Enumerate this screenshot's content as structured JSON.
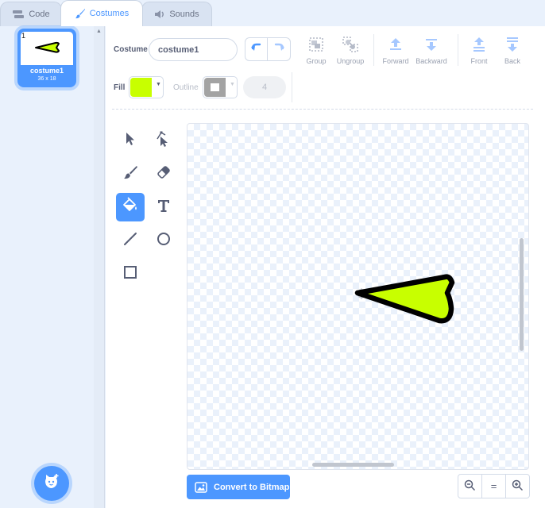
{
  "tabs": [
    {
      "label": "Code",
      "icon": "code-blocks-icon"
    },
    {
      "label": "Costumes",
      "icon": "paintbrush-icon"
    },
    {
      "label": "Sounds",
      "icon": "speaker-icon"
    }
  ],
  "sidebar": {
    "costume": {
      "number": "1",
      "name": "costume1",
      "size": "36 x 18"
    },
    "choose_button_icon": "cat-plus-icon"
  },
  "toolbar": {
    "costume_label": "Costume",
    "costume_name": "costume1",
    "group_label": "Group",
    "ungroup_label": "Ungroup",
    "forward_label": "Forward",
    "backward_label": "Backward",
    "front_label": "Front",
    "back_label": "Back",
    "fill_label": "Fill",
    "fill_color": "#c8ff00",
    "outline_label": "Outline",
    "outline_size": "4"
  },
  "tools": [
    {
      "name": "select",
      "selected": false
    },
    {
      "name": "reshape",
      "selected": false
    },
    {
      "name": "brush",
      "selected": false
    },
    {
      "name": "eraser",
      "selected": false
    },
    {
      "name": "fill",
      "selected": true
    },
    {
      "name": "text",
      "selected": false
    },
    {
      "name": "line",
      "selected": false
    },
    {
      "name": "circle",
      "selected": false
    },
    {
      "name": "rectangle",
      "selected": false
    }
  ],
  "canvas": {
    "shape_fill": "#c8ff00",
    "shape_stroke": "#000000"
  },
  "footer": {
    "convert_label": "Convert to Bitmap",
    "zoom_reset_label": "="
  },
  "colors": {
    "accent": "#4c97ff",
    "text": "#575e75"
  }
}
